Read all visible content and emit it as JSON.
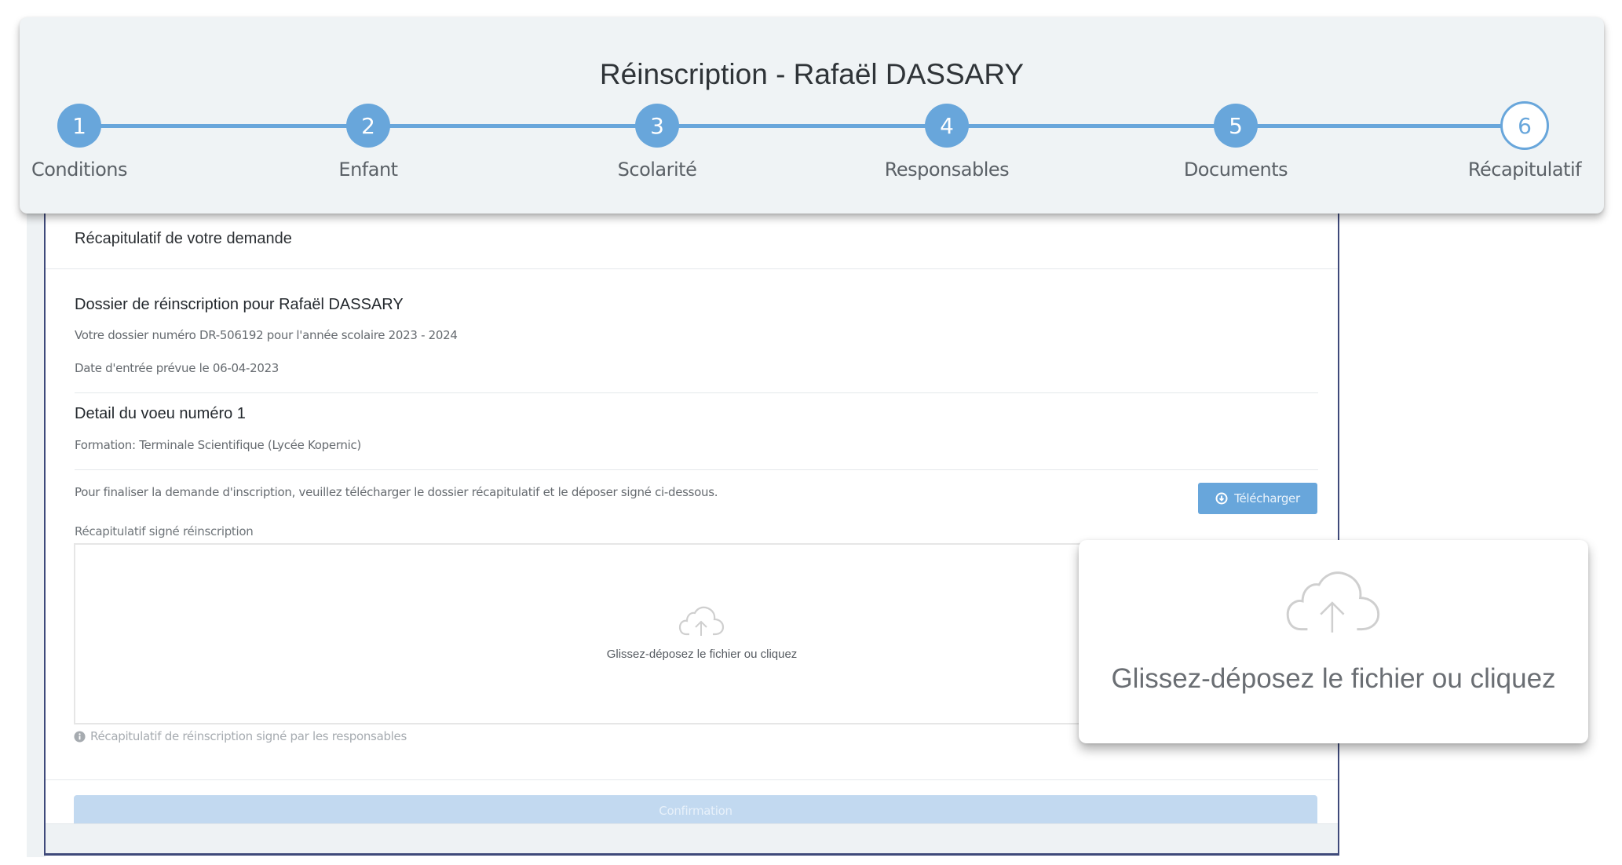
{
  "header": {
    "title": "Réinscription - Rafaël DASSARY",
    "steps": [
      {
        "number": "1",
        "label": "Conditions",
        "state": "done"
      },
      {
        "number": "2",
        "label": "Enfant",
        "state": "done"
      },
      {
        "number": "3",
        "label": "Scolarité",
        "state": "done"
      },
      {
        "number": "4",
        "label": "Responsables",
        "state": "done"
      },
      {
        "number": "5",
        "label": "Documents",
        "state": "done"
      },
      {
        "number": "6",
        "label": "Récapitulatif",
        "state": "current"
      }
    ],
    "accent_color": "#68a6db"
  },
  "card": {
    "title": "Récapitulatif de votre demande",
    "dossier": {
      "heading": "Dossier de réinscription pour Rafaël DASSARY",
      "number_line": "Votre dossier numéro DR-506192 pour l'année scolaire 2023 - 2024",
      "date_line": "Date d'entrée prévue le 06-04-2023"
    },
    "voeu": {
      "heading": "Detail du voeu numéro 1",
      "formation": "Formation: Terminale Scientifique (Lycée Kopernic)"
    },
    "instruction": "Pour finaliser la demande d'inscription, veuillez télécharger le dossier récapitulatif et le déposer signé ci-dessous.",
    "download_button": {
      "label": "Télécharger",
      "icon": "download-circle-icon"
    },
    "upload": {
      "label": "Récapitulatif signé réinscription",
      "dropzone_text": "Glissez-déposez le fichier ou cliquez",
      "icon": "cloud-upload-icon",
      "help_text": "Récapitulatif de réinscription signé par les responsables",
      "help_icon": "info-circle-icon"
    },
    "confirm_button": {
      "label": "Confirmation",
      "disabled": true
    }
  },
  "popup": {
    "text": "Glissez-déposez le fichier ou cliquez",
    "icon": "cloud-upload-icon"
  }
}
